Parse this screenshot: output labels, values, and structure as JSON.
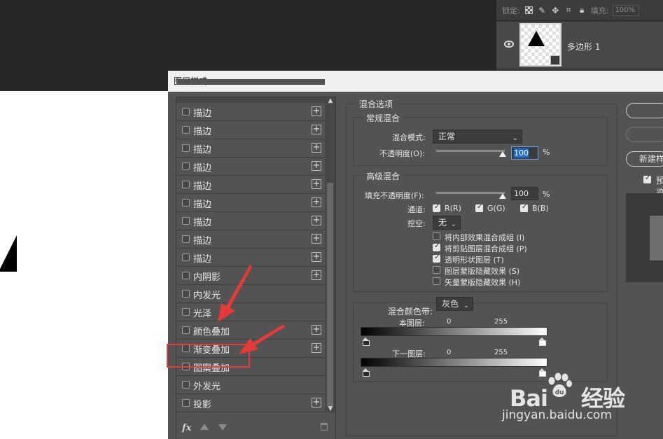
{
  "layers_panel": {
    "lock_label": "锁定:",
    "fill_label": "填充:",
    "fill_value": "100%",
    "layer_name": "多边形 1"
  },
  "dialog": {
    "title": "图层样式"
  },
  "style_list": {
    "items": [
      {
        "label": "描边",
        "checked": false,
        "has_plus": true
      },
      {
        "label": "描边",
        "checked": false,
        "has_plus": true
      },
      {
        "label": "描边",
        "checked": false,
        "has_plus": true
      },
      {
        "label": "描边",
        "checked": false,
        "has_plus": true
      },
      {
        "label": "描边",
        "checked": false,
        "has_plus": true
      },
      {
        "label": "描边",
        "checked": false,
        "has_plus": true
      },
      {
        "label": "描边",
        "checked": false,
        "has_plus": true
      },
      {
        "label": "描边",
        "checked": false,
        "has_plus": true
      },
      {
        "label": "描边",
        "checked": false,
        "has_plus": true
      },
      {
        "label": "内阴影",
        "checked": false,
        "has_plus": true
      },
      {
        "label": "内发光",
        "checked": false,
        "has_plus": false
      },
      {
        "label": "光泽",
        "checked": false,
        "has_plus": false
      },
      {
        "label": "颜色叠加",
        "checked": false,
        "has_plus": true
      },
      {
        "label": "渐变叠加",
        "checked": false,
        "has_plus": true
      },
      {
        "label": "图案叠加",
        "checked": false,
        "has_plus": false
      },
      {
        "label": "外发光",
        "checked": false,
        "has_plus": false
      },
      {
        "label": "投影",
        "checked": false,
        "has_plus": true
      }
    ],
    "fx_label": "fx"
  },
  "blend_options": {
    "section_title": "混合选项",
    "general": {
      "title": "常规混合",
      "blend_mode_label": "混合模式:",
      "blend_mode_value": "正常",
      "opacity_label": "不透明度(O):",
      "opacity_value": "100",
      "opacity_unit": "%",
      "opacity_level": 1.0
    },
    "advanced": {
      "title": "高级混合",
      "fill_opacity_label": "填充不透明度(F):",
      "fill_opacity_value": "100",
      "fill_opacity_unit": "%",
      "fill_opacity_level": 1.0,
      "channels_label": "通道:",
      "channels": [
        {
          "label": "R(R)",
          "checked": true
        },
        {
          "label": "G(G)",
          "checked": true
        },
        {
          "label": "B(B)",
          "checked": true
        }
      ],
      "knockout_label": "挖空:",
      "knockout_value": "无",
      "options": [
        {
          "label": "将内部效果混合成组 (I)",
          "checked": false
        },
        {
          "label": "将剪贴图层混合成组 (P)",
          "checked": true
        },
        {
          "label": "透明形状图层 (T)",
          "checked": true
        },
        {
          "label": "图层蒙版隐藏效果 (S)",
          "checked": false
        },
        {
          "label": "矢量蒙版隐藏效果 (H)",
          "checked": false
        }
      ]
    },
    "blend_if": {
      "label": "混合颜色带:",
      "value": "灰色",
      "this_layer_label": "本图层:",
      "this_layer_low": "0",
      "this_layer_high": "255",
      "underlying_label": "下一图层:",
      "underlying_low": "0",
      "underlying_high": "255"
    }
  },
  "right_buttons": {
    "new_style_label": "新建样式",
    "preview_label": "预览",
    "preview_checked": true
  },
  "watermark": {
    "brand": "Bai",
    "brand_suffix": "经验",
    "url": "jingyan.baidu.com"
  }
}
